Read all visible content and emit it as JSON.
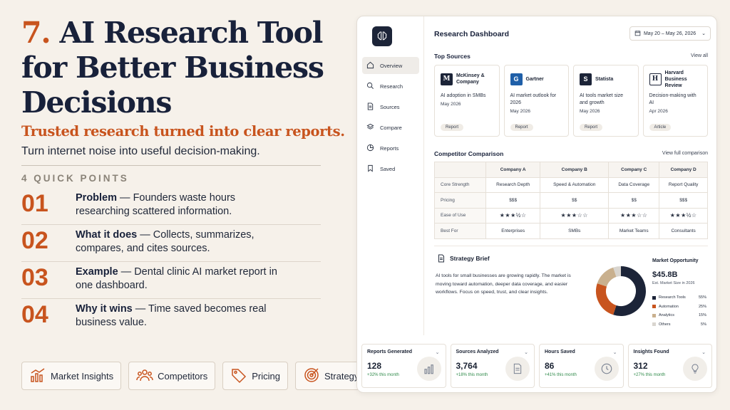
{
  "headline": {
    "number": "7.",
    "line1": " AI Research Tool",
    "line2": "for Better Business",
    "line3": "Decisions"
  },
  "subhead": "Trusted research turned into clear reports.",
  "tagline": "Turn internet noise into useful decision-making.",
  "quick_points_title": "4 QUICK POINTS",
  "points": [
    {
      "num": "01",
      "bold": "Problem",
      "text": " — Founders waste hours researching scattered information."
    },
    {
      "num": "02",
      "bold": "What it does",
      "text": " — Collects, summarizes, compares, and cites sources."
    },
    {
      "num": "03",
      "bold": "Example",
      "text": " — Dental clinic AI market report in one dashboard."
    },
    {
      "num": "04",
      "bold": "Why it wins",
      "text": " — Time saved becomes real business value."
    }
  ],
  "chips": [
    {
      "label": "Market Insights",
      "icon": "bar-chart-icon"
    },
    {
      "label": "Competitors",
      "icon": "people-icon"
    },
    {
      "label": "Pricing",
      "icon": "tag-icon"
    },
    {
      "label": "Strategy",
      "icon": "target-icon"
    }
  ],
  "dashboard": {
    "title": "Research Dashboard",
    "date_range": "May 20 – May 26, 2026",
    "nav": [
      "Overview",
      "Research",
      "Sources",
      "Compare",
      "Reports",
      "Saved"
    ],
    "top_sources_title": "Top Sources",
    "view_all": "View all",
    "sources": [
      {
        "name": "McKinsey & Company",
        "logo": "M",
        "color": "#1c2438",
        "desc": "AI adoption in SMBs",
        "date": "May 2026",
        "tag": "Report"
      },
      {
        "name": "Gartner",
        "logo": "G",
        "color": "#1f5fa8",
        "desc": "AI market outlook for 2026",
        "date": "May 2026",
        "tag": "Report"
      },
      {
        "name": "Statista",
        "logo": "S",
        "color": "#1c2438",
        "desc": "AI tools market size and growth",
        "date": "May 2026",
        "tag": "Report"
      },
      {
        "name": "Harvard Business Review",
        "logo": "H",
        "color": "#ffffff",
        "desc": "Decision-making with AI",
        "date": "Apr 2026",
        "tag": "Article"
      }
    ],
    "comparison_title": "Competitor Comparison",
    "view_full": "View full comparison",
    "comparison": {
      "headers": [
        "",
        "Company A",
        "Company B",
        "Company C",
        "Company D"
      ],
      "rows": [
        {
          "label": "Core Strength",
          "cells": [
            "Research Depth",
            "Speed & Automation",
            "Data Coverage",
            "Report Quality"
          ]
        },
        {
          "label": "Pricing",
          "cells": [
            "$$$",
            "$$",
            "$$",
            "$$$"
          ]
        },
        {
          "label": "Ease of Use",
          "cells": [
            "★★★½☆",
            "★★★☆☆",
            "★★★☆☆",
            "★★★½☆"
          ]
        },
        {
          "label": "Best For",
          "cells": [
            "Enterprises",
            "SMBs",
            "Market Teams",
            "Consultants"
          ]
        }
      ]
    },
    "brief_title": "Strategy Brief",
    "brief_text": "AI tools for small businesses are growing rapidly. The market is moving toward automation, deeper data coverage, and easier workflows. Focus on speed, trust, and clear insights.",
    "market_title": "Market Opportunity",
    "market_value": "$45.8B",
    "market_sub": "Est. Market Size in 2026",
    "market_segments": [
      {
        "label": "Research Tools",
        "pct": "55%",
        "value": 55,
        "color": "#1c2438"
      },
      {
        "label": "Automation",
        "pct": "25%",
        "value": 25,
        "color": "#c8541e"
      },
      {
        "label": "Analytics",
        "pct": "15%",
        "value": 15,
        "color": "#c9b08e"
      },
      {
        "label": "Others",
        "pct": "5%",
        "value": 5,
        "color": "#d9d5cf"
      }
    ],
    "stats": [
      {
        "label": "Reports Generated",
        "value": "128",
        "change": "+32% this month",
        "icon": "bar-chart-icon"
      },
      {
        "label": "Sources Analyzed",
        "value": "3,764",
        "change": "+18% this month",
        "icon": "document-icon"
      },
      {
        "label": "Hours Saved",
        "value": "86",
        "change": "+41% this month",
        "icon": "clock-icon"
      },
      {
        "label": "Insights Found",
        "value": "312",
        "change": "+27% this month",
        "icon": "lightbulb-icon"
      }
    ]
  }
}
